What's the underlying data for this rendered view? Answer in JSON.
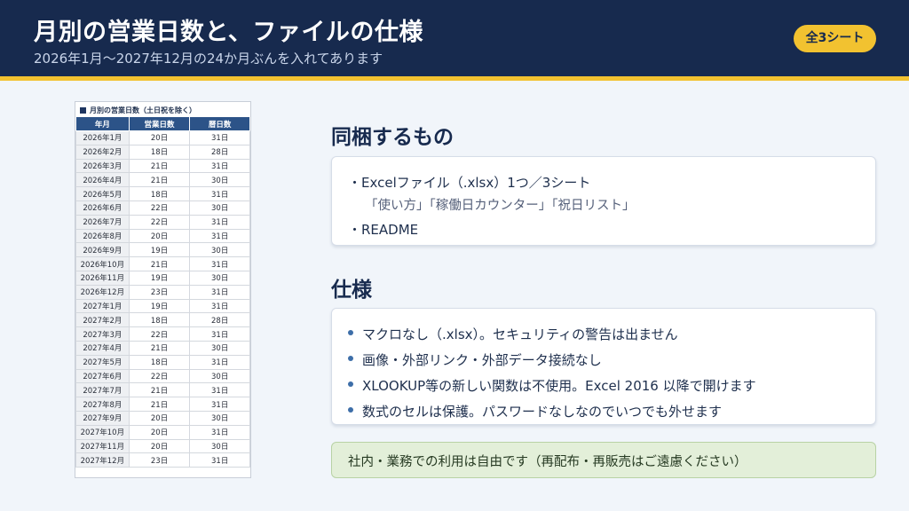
{
  "header": {
    "title": "月別の営業日数と、ファイルの仕様",
    "subtitle": "2026年1月～2027年12月の24か月ぶんを入れてあります",
    "badge": "全3シート"
  },
  "table": {
    "caption": "月別の営業日数（土日祝を除く）",
    "columns": [
      "年月",
      "営業日数",
      "暦日数"
    ],
    "rows": [
      [
        "2026年1月",
        "20日",
        "31日"
      ],
      [
        "2026年2月",
        "18日",
        "28日"
      ],
      [
        "2026年3月",
        "21日",
        "31日"
      ],
      [
        "2026年4月",
        "21日",
        "30日"
      ],
      [
        "2026年5月",
        "18日",
        "31日"
      ],
      [
        "2026年6月",
        "22日",
        "30日"
      ],
      [
        "2026年7月",
        "22日",
        "31日"
      ],
      [
        "2026年8月",
        "20日",
        "31日"
      ],
      [
        "2026年9月",
        "19日",
        "30日"
      ],
      [
        "2026年10月",
        "21日",
        "31日"
      ],
      [
        "2026年11月",
        "19日",
        "30日"
      ],
      [
        "2026年12月",
        "23日",
        "31日"
      ],
      [
        "2027年1月",
        "19日",
        "31日"
      ],
      [
        "2027年2月",
        "18日",
        "28日"
      ],
      [
        "2027年3月",
        "22日",
        "31日"
      ],
      [
        "2027年4月",
        "21日",
        "30日"
      ],
      [
        "2027年5月",
        "18日",
        "31日"
      ],
      [
        "2027年6月",
        "22日",
        "30日"
      ],
      [
        "2027年7月",
        "21日",
        "31日"
      ],
      [
        "2027年8月",
        "21日",
        "31日"
      ],
      [
        "2027年9月",
        "20日",
        "30日"
      ],
      [
        "2027年10月",
        "20日",
        "31日"
      ],
      [
        "2027年11月",
        "20日",
        "30日"
      ],
      [
        "2027年12月",
        "23日",
        "31日"
      ]
    ]
  },
  "bundle": {
    "title": "同梱するもの",
    "item1": "・Excelファイル（.xlsx）1つ／3シート",
    "item1_sub": "「使い方」「稼働日カウンター」「祝日リスト」",
    "item2": "・README"
  },
  "spec": {
    "title": "仕様",
    "items": [
      "マクロなし（.xlsx）。セキュリティの警告は出ません",
      "画像・外部リンク・外部データ接続なし",
      "XLOOKUP等の新しい関数は不使用。Excel 2016 以降で開けます",
      "数式のセルは保護。パスワードなしなのでいつでも外せます"
    ]
  },
  "note": "社内・業務での利用は自由です（再配布・再販売はご遠慮ください）",
  "colors": {
    "header_bg": "#172a4e",
    "accent_yellow": "#f2c230",
    "table_header": "#2c5388",
    "note_bg": "#e3efd9"
  }
}
